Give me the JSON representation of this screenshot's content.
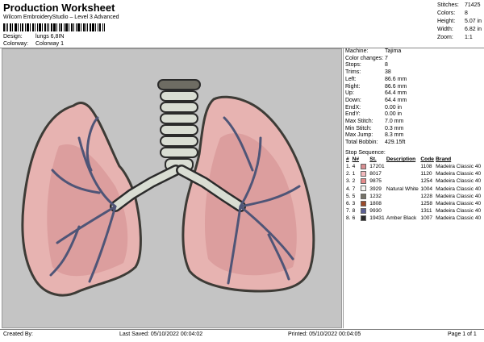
{
  "header": {
    "title": "Production Worksheet",
    "subtitle": "Wilcom EmbroideryStudio – Level 3 Advanced",
    "design_label": "Design:",
    "design_value": "lungs 6,8IN",
    "colorway_label": "Colorway:",
    "colorway_value": "Colorway 1"
  },
  "summary": [
    {
      "label": "Stitches:",
      "value": "71425"
    },
    {
      "label": "Colors:",
      "value": "8"
    },
    {
      "label": "Height:",
      "value": "5.07 in"
    },
    {
      "label": "Width:",
      "value": "6.82 in"
    },
    {
      "label": "Zoom:",
      "value": "1:1"
    }
  ],
  "stats": [
    {
      "label": "Machine:",
      "value": "Tajima"
    },
    {
      "label": "Color changes:",
      "value": "7"
    },
    {
      "label": "Stops:",
      "value": "8"
    },
    {
      "label": "Trims:",
      "value": "38"
    },
    {
      "label": "Left:",
      "value": "86.6 mm"
    },
    {
      "label": "Right:",
      "value": "86.6 mm"
    },
    {
      "label": "Up:",
      "value": "64.4 mm"
    },
    {
      "label": "Down:",
      "value": "64.4 mm"
    },
    {
      "label": "EndX:",
      "value": "0.00 in"
    },
    {
      "label": "EndY:",
      "value": "0.00 in"
    },
    {
      "label": "Max Stitch:",
      "value": "7.0 mm"
    },
    {
      "label": "Min Stitch:",
      "value": "0.3 mm"
    },
    {
      "label": "Max Jump:",
      "value": "8.3 mm"
    },
    {
      "label": "Total Bobbin:",
      "value": "429.15ft"
    }
  ],
  "sequence": {
    "title": "Stop Sequence:",
    "headers": [
      "#",
      "N#",
      "",
      "St.",
      "Description",
      "Code",
      "Brand"
    ],
    "rows": [
      {
        "n": "1.",
        "needle": "4",
        "color": "#d98f92",
        "st": "17201",
        "desc": "",
        "code": "1108",
        "brand": "Madeira Classic 40"
      },
      {
        "n": "2.",
        "needle": "1",
        "color": "#f2b9bd",
        "st": "8017",
        "desc": "",
        "code": "1120",
        "brand": "Madeira Classic 40"
      },
      {
        "n": "3.",
        "needle": "2",
        "color": "#e48a8a",
        "st": "9875",
        "desc": "",
        "code": "1254",
        "brand": "Madeira Classic 40"
      },
      {
        "n": "4.",
        "needle": "7",
        "color": "#f4f4f0",
        "st": "3929",
        "desc": "Natural White",
        "code": "1004",
        "brand": "Madeira Classic 40"
      },
      {
        "n": "5.",
        "needle": "5",
        "color": "#767368",
        "st": "1232",
        "desc": "",
        "code": "1228",
        "brand": "Madeira Classic 40"
      },
      {
        "n": "6.",
        "needle": "3",
        "color": "#9b4a2a",
        "st": "1808",
        "desc": "",
        "code": "1258",
        "brand": "Madeira Classic 40"
      },
      {
        "n": "7.",
        "needle": "8",
        "color": "#5b5f93",
        "st": "9930",
        "desc": "",
        "code": "1311",
        "brand": "Madeira Classic 40"
      },
      {
        "n": "8.",
        "needle": "6",
        "color": "#2b2b2b",
        "st": "19431",
        "desc": "Amber Black",
        "code": "1007",
        "brand": "Madeira Classic 40"
      }
    ]
  },
  "footer": {
    "created_by": "Created By:",
    "last_saved": "Last Saved: 05/10/2022 00:04:02",
    "printed": "Printed: 05/10/2022 00:04:05",
    "page": "Page 1 of 1"
  }
}
